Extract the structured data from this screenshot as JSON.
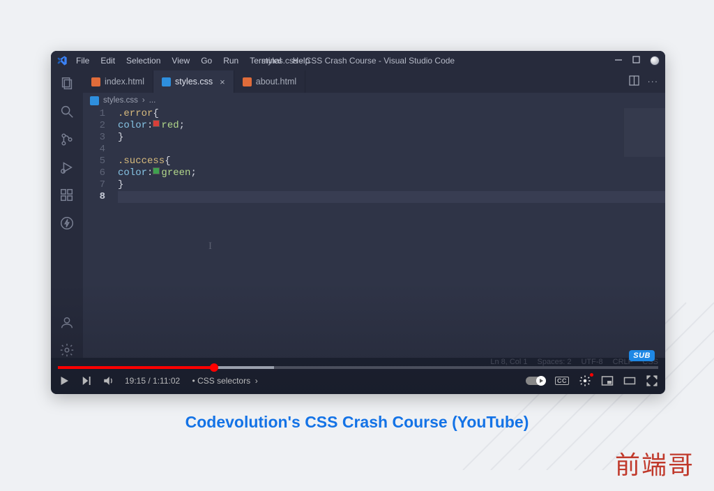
{
  "titlebar": {
    "menu": [
      "File",
      "Edit",
      "Selection",
      "View",
      "Go",
      "Run",
      "Terminal",
      "Help"
    ],
    "title": "styles.css - CSS Crash Course - Visual Studio Code"
  },
  "tabs": [
    {
      "name": "index.html",
      "icon": "html",
      "active": false
    },
    {
      "name": "styles.css",
      "icon": "css",
      "active": true,
      "close": true
    },
    {
      "name": "about.html",
      "icon": "html",
      "active": false
    }
  ],
  "breadcrumb": {
    "file": "styles.css",
    "sep": "›",
    "rest": "..."
  },
  "code": {
    "lines": [
      {
        "n": "1",
        "frags": [
          {
            "t": "  "
          },
          {
            "t": ".error",
            "c": "tk-sel"
          },
          {
            "t": " "
          },
          {
            "t": "{",
            "c": "tk-punc"
          }
        ]
      },
      {
        "n": "2",
        "frags": [
          {
            "t": "    "
          },
          {
            "t": "color",
            "c": "tk-prop"
          },
          {
            "t": ": ",
            "c": "tk-punc"
          },
          {
            "sw": "sw-red"
          },
          {
            "t": "red",
            "c": "tk-val"
          },
          {
            "t": ";",
            "c": "tk-punc"
          }
        ]
      },
      {
        "n": "3",
        "frags": [
          {
            "t": "  "
          },
          {
            "t": "}",
            "c": "tk-punc"
          }
        ]
      },
      {
        "n": "4",
        "frags": []
      },
      {
        "n": "5",
        "frags": [
          {
            "t": "  "
          },
          {
            "t": ".success",
            "c": "tk-sel"
          },
          {
            "t": " "
          },
          {
            "t": "{",
            "c": "tk-punc"
          }
        ]
      },
      {
        "n": "6",
        "frags": [
          {
            "t": "    "
          },
          {
            "t": "color",
            "c": "tk-prop"
          },
          {
            "t": ": ",
            "c": "tk-punc"
          },
          {
            "sw": "sw-green"
          },
          {
            "t": "green",
            "c": "tk-val"
          },
          {
            "t": ";",
            "c": "tk-punc"
          }
        ]
      },
      {
        "n": "7",
        "frags": [
          {
            "t": "  "
          },
          {
            "t": "}",
            "c": "tk-punc"
          }
        ]
      },
      {
        "n": "8",
        "frags": [],
        "hl": true
      }
    ]
  },
  "statusbar": {
    "items": [
      "Ln 8, Col 1",
      "Spaces: 2",
      "UTF-8",
      "CRLF",
      "CSS"
    ]
  },
  "youtube": {
    "current": "19:15",
    "total": "1:11:02",
    "chapter": "CSS selectors",
    "played_pct": 26,
    "buffered_pct": 36,
    "cc": "CC",
    "sub": "SUB"
  },
  "caption": "Codevolution's CSS Crash Course (YouTube)",
  "watermark": "前端哥"
}
